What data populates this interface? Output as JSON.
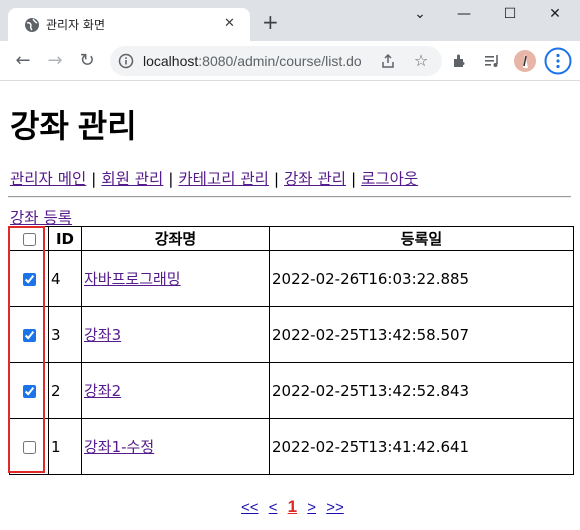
{
  "browser": {
    "tab_title": "관리자 화면",
    "tab_close": "✕",
    "new_tab": "+",
    "window_controls": {
      "minimize": "⌄",
      "min2": "—",
      "maximize": "☐",
      "close": "✕"
    },
    "url_host": "localhost",
    "url_rest": ":8080/admin/course/list.do",
    "icons": [
      "back-icon",
      "forward-icon",
      "reload-icon",
      "info-icon",
      "share-icon",
      "star-icon",
      "extensions-icon",
      "media-icon",
      "profile-avatar",
      "menu-icon"
    ]
  },
  "page": {
    "title": "강좌 관리",
    "menu": [
      {
        "label": "관리자 메인"
      },
      {
        "label": "회원 관리"
      },
      {
        "label": "카테고리 관리"
      },
      {
        "label": "강좌 관리"
      },
      {
        "label": "로그아웃"
      }
    ],
    "separator": "|",
    "register_link": "강좌 등록",
    "table": {
      "headers": {
        "id": "ID",
        "name": "강좌명",
        "date": "등록일"
      },
      "rows": [
        {
          "id": "4",
          "name": "자바프로그래밍",
          "date": "2022-02-26T16:03:22.885",
          "checked": true
        },
        {
          "id": "3",
          "name": "강좌3",
          "date": "2022-02-25T13:42:58.507",
          "checked": true
        },
        {
          "id": "2",
          "name": "강좌2",
          "date": "2022-02-25T13:42:52.843",
          "checked": true
        },
        {
          "id": "1",
          "name": "강좌1-수정",
          "date": "2022-02-25T13:41:42.641",
          "checked": false
        }
      ]
    },
    "pager": {
      "first": "<<",
      "prev": "<",
      "current": "1",
      "next": ">",
      "last": ">>"
    },
    "colors": {
      "highlight_box": "#e02a2a",
      "link": "#551a8b"
    }
  }
}
